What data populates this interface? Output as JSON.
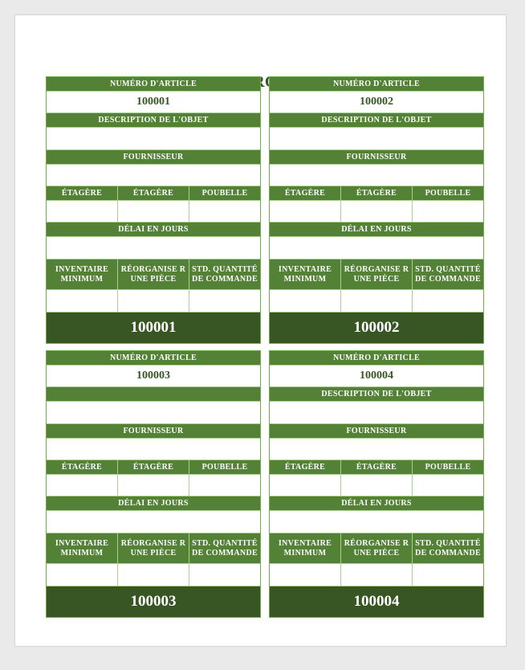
{
  "document": {
    "title": "CARTE KANBAN STOCKROOM"
  },
  "cards": [
    {
      "item_number_label": "NUMÉRO D'ARTICLE",
      "item_number": "100001",
      "description_label": "DESCRIPTION DE L'OBJET",
      "description": "",
      "supplier_label": "FOURNISSEUR",
      "supplier": "",
      "location_headers": [
        "ÉTAGÈRE",
        "ÉTAGÈRE",
        "POUBELLE"
      ],
      "location_values": [
        "",
        "",
        ""
      ],
      "lead_time_label": "DÉLAI EN JOURS",
      "lead_time": "",
      "qty_headers": [
        "INVENTAIRE MINIMUM",
        "RÉORGANISE R UNE PIÈCE",
        "STD. QUANTITÉ DE COMMANDE"
      ],
      "qty_values": [
        "",
        "",
        ""
      ],
      "footer_number": "100001"
    },
    {
      "item_number_label": "NUMÉRO D'ARTICLE",
      "item_number": "100002",
      "description_label": "DESCRIPTION DE L'OBJET",
      "description": "",
      "supplier_label": "FOURNISSEUR",
      "supplier": "",
      "location_headers": [
        "ÉTAGÈRE",
        "ÉTAGÈRE",
        "POUBELLE"
      ],
      "location_values": [
        "",
        "",
        ""
      ],
      "lead_time_label": "DÉLAI EN JOURS",
      "lead_time": "",
      "qty_headers": [
        "INVENTAIRE MINIMUM",
        "RÉORGANISE R UNE PIÈCE",
        "STD. QUANTITÉ DE COMMANDE"
      ],
      "qty_values": [
        "",
        "",
        ""
      ],
      "footer_number": "100002"
    },
    {
      "item_number_label": "NUMÉRO D'ARTICLE",
      "item_number": "100003",
      "description_label": "",
      "description": "",
      "supplier_label": "FOURNISSEUR",
      "supplier": "",
      "location_headers": [
        "ÉTAGÈRE",
        "ÉTAGÈRE",
        "POUBELLE"
      ],
      "location_values": [
        "",
        "",
        ""
      ],
      "lead_time_label": "DÉLAI EN JOURS",
      "lead_time": "",
      "qty_headers": [
        "INVENTAIRE MINIMUM",
        "RÉORGANISE R UNE PIÈCE",
        "STD. QUANTITÉ DE COMMANDE"
      ],
      "qty_values": [
        "",
        "",
        ""
      ],
      "footer_number": "100003"
    },
    {
      "item_number_label": "NUMÉRO D'ARTICLE",
      "item_number": "100004",
      "description_label": "DESCRIPTION DE L'OBJET",
      "description": "",
      "supplier_label": "FOURNISSEUR",
      "supplier": "",
      "location_headers": [
        "ÉTAGÈRE",
        "ÉTAGÈRE",
        "POUBELLE"
      ],
      "location_values": [
        "",
        "",
        ""
      ],
      "lead_time_label": "DÉLAI EN JOURS",
      "lead_time": "",
      "qty_headers": [
        "INVENTAIRE MINIMUM",
        "RÉORGANISE R UNE PIÈCE",
        "STD. QUANTITÉ DE COMMANDE"
      ],
      "qty_values": [
        "",
        "",
        ""
      ],
      "footer_number": "100004"
    }
  ],
  "colors": {
    "header_green": "#538135",
    "footer_dark_green": "#375623",
    "border_green": "#70ad47",
    "title_color": "#375623"
  }
}
